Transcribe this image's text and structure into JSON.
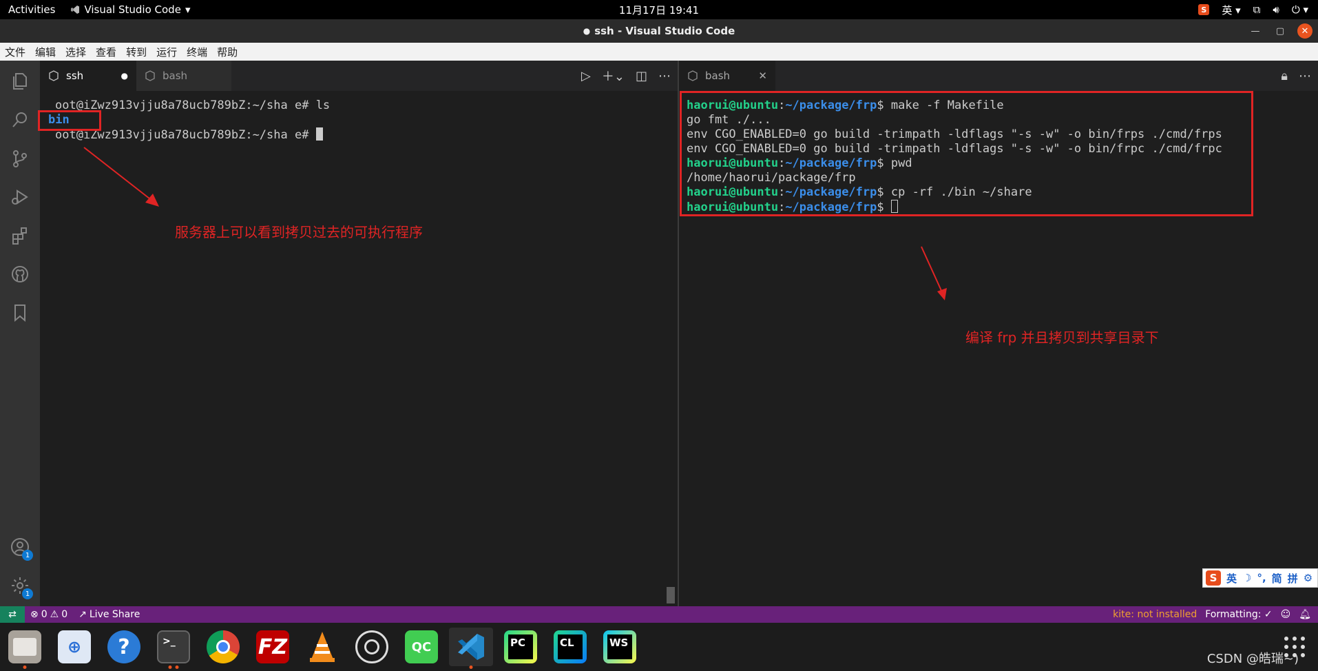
{
  "topbar": {
    "activities": "Activities",
    "app_name": "Visual Studio Code",
    "clock": "11月17日  19:41",
    "ime_label": "英"
  },
  "window": {
    "title": "ssh - Visual Studio Code",
    "modified_dot": "●"
  },
  "menu": [
    "文件",
    "编辑",
    "选择",
    "查看",
    "转到",
    "运行",
    "终端",
    "帮助"
  ],
  "activity_badges": {
    "accounts": "1",
    "manage": "1"
  },
  "left_pane": {
    "tabs": [
      {
        "label": "ssh",
        "dirty": "●"
      },
      {
        "label": "bash"
      }
    ],
    "terminal": {
      "line1": "oot@iZwz913vjju8a78ucb789bZ:~/sha e# ls",
      "line2": "bin",
      "line3": "oot@iZwz913vjju8a78ucb789bZ:~/sha e# "
    },
    "annotation": "服务器上可以看到拷贝过去的可执行程序"
  },
  "right_pane": {
    "tab": {
      "label": "bash"
    },
    "terminal": {
      "user": "haorui@ubuntu",
      "path": "~/package/frp",
      "cmd1": "make -f Makefile",
      "out1": "go fmt ./...",
      "out2": "env CGO_ENABLED=0 go build -trimpath -ldflags \"-s -w\" -o bin/frps ./cmd/frps",
      "out3": "env CGO_ENABLED=0 go build -trimpath -ldflags \"-s -w\" -o bin/frpc ./cmd/frpc",
      "cmd2": "pwd",
      "out4": "/home/haorui/package/frp",
      "cmd3": "cp -rf ./bin ~/share",
      "cmd4": ""
    },
    "annotation": "编译 frp 并且拷贝到共享目录下"
  },
  "statusbar": {
    "errors": "0",
    "warnings": "0",
    "live_share": "Live Share",
    "kite": "kite: not installed",
    "formatting": "Formatting: ✓"
  },
  "ime_bar": {
    "logo": "S",
    "items": [
      "英",
      "☽",
      "°,",
      "简",
      "拼",
      "⚙"
    ]
  },
  "dock": {
    "apps": [
      "files-icon",
      "software-icon",
      "help-icon",
      "terminal-icon",
      "chrome-icon",
      "filezilla-icon",
      "vlc-icon",
      "obs-icon",
      "qtcreator-icon",
      "vscode-icon",
      "pycharm-icon",
      "clion-icon",
      "webstorm-icon"
    ],
    "labels": {
      "qt": "QC",
      "pycharm": "PC",
      "clion": "CL",
      "webstorm": "WS",
      "filezilla": "FZ"
    },
    "watermark": "CSDN @皓瑞~)"
  },
  "colors": {
    "statusbar": "#68217a",
    "annotation": "#e02424",
    "prompt_user": "#23d18b",
    "prompt_path": "#3b8eea"
  }
}
